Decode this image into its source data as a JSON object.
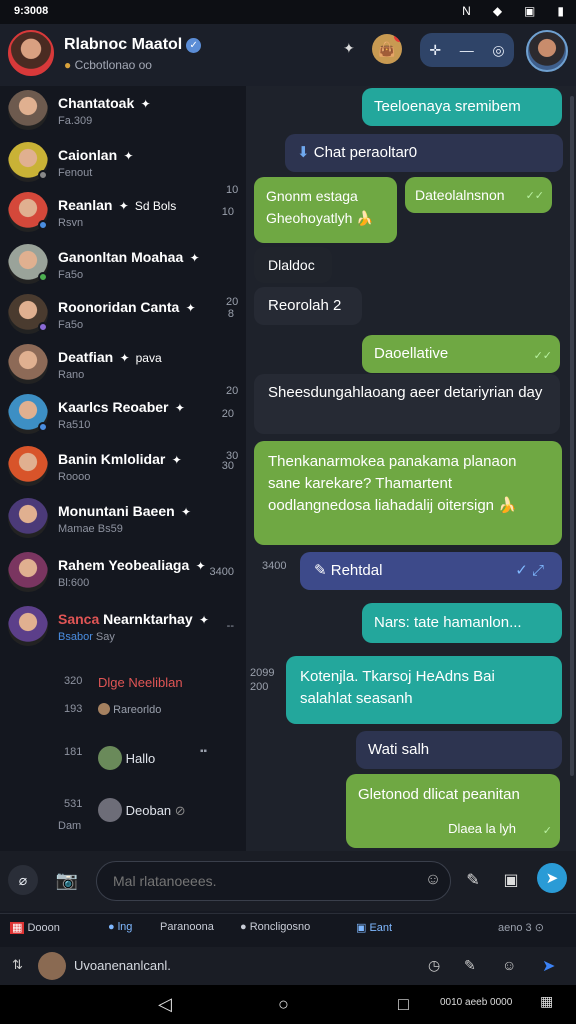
{
  "status_bar": {
    "time": "9:3008",
    "icons": [
      "N",
      "◆",
      "▣",
      "▮"
    ]
  },
  "header": {
    "title": "Rlabnoc Maatol",
    "subtitle": "Ccbotlonao oo",
    "actions": [
      "✛",
      "—",
      "◎"
    ]
  },
  "chats": [
    {
      "name": "Chantatoak",
      "preview": "Fa.309",
      "meta": "",
      "color": "#6d5a4e"
    },
    {
      "name": "Caionlan",
      "preview": "Fenout",
      "meta": "",
      "color": "#c9b236"
    },
    {
      "name": "Reanlan",
      "preview": "Rsvn",
      "meta": "10",
      "extra": "Sd Bols",
      "color": "#d4483a"
    },
    {
      "name": "Ganonltan Moahaa",
      "preview": "Fa5o",
      "meta": "",
      "color": "#9aa39a"
    },
    {
      "name": "Roonoridan Canta",
      "preview": "Fa5o",
      "meta": "8",
      "color": "#4a3b2f"
    },
    {
      "name": "Deatfian",
      "preview": "Rano",
      "extra": "pava",
      "meta": "",
      "color": "#8d6a57"
    },
    {
      "name": "Kaarlcs Reoaber",
      "preview": "Ra510",
      "meta": "20",
      "color": "#3d8fc4"
    },
    {
      "name": "Banin Kmlolidar",
      "preview": "Roooo",
      "meta": "30",
      "color": "#d8542a"
    },
    {
      "name": "Monuntani Baeen",
      "preview": "Mamae Bs59",
      "meta": "",
      "color": "#4b3a78"
    },
    {
      "name": "Rahem Yeobealiaga",
      "preview": "Bl:600",
      "meta": "3400",
      "color": "#7a3560"
    },
    {
      "name": "Nearnktarhay",
      "preview": "Say",
      "prefix": "Sanca",
      "prefix2": "Bsabor",
      "meta": "--",
      "color": "#5c3f8a"
    }
  ],
  "sub_threads": [
    {
      "time": "320",
      "text": "Dlge Neeliblan",
      "color": "#e05555"
    },
    {
      "time": "193",
      "text": "Rareorldo"
    },
    {
      "time": "181",
      "text": "Hallo"
    },
    {
      "time": "531",
      "text": "Deoban",
      "sub": "Dam"
    }
  ],
  "messages": [
    {
      "text": "Teeloenaya sremibem",
      "style": "teal"
    },
    {
      "text": "Chat peraoltar0",
      "style": "navy"
    },
    {
      "text": "Gnonm estaga Gheohoyatlyh",
      "style": "green"
    },
    {
      "text": "Dateolalnsnon",
      "style": "green"
    },
    {
      "text": "Dlaldoc",
      "style": "darker"
    },
    {
      "text": "Reorolah 2",
      "style": "dark"
    },
    {
      "text": "Daoellative",
      "style": "green"
    },
    {
      "text": "Sheesdungahlaoang aeer detariyrian day",
      "style": "dark"
    },
    {
      "text": "Thenkanarmokea panakama planaon sane karekare? Thamartent oodlangnedosa liahadalij oitersign",
      "style": "green"
    },
    {
      "text": "Rehtdal",
      "style": "blu"
    },
    {
      "text": "Nars: tate hamanlon...",
      "style": "teal"
    },
    {
      "text": "Kotenjla. Tkarsoj HeAdns Bai salahlat seasanh",
      "style": "teal"
    },
    {
      "text": "Wati salh",
      "style": "navy"
    },
    {
      "text": "Gletonod dlicat peanitan",
      "style": "green"
    },
    {
      "text": "Dlaea la lyh",
      "style": "green"
    }
  ],
  "timestamps": [
    "10",
    "20",
    "30",
    "3400",
    "2099",
    "200"
  ],
  "composer": {
    "placeholder": "Mal rlatanoeees."
  },
  "tabs": [
    "Dooon",
    "lng",
    "Paranoona",
    "Roncligosno",
    "Eant",
    "aeno 3"
  ],
  "quick_bar": {
    "text": "Uvoanenanlcanl."
  },
  "nav": {
    "right": "0010 aeeb 0000"
  }
}
